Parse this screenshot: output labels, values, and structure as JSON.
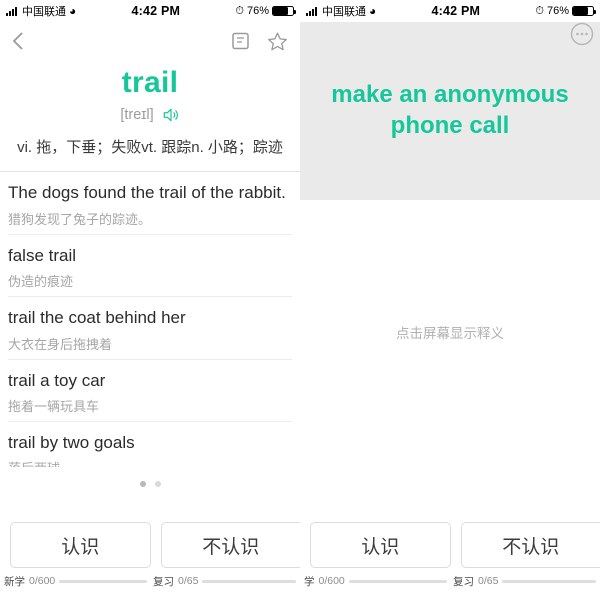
{
  "status_bar": {
    "carrier": "中国联通",
    "wifi_icon": "wifi-icon",
    "time": "4:42 PM",
    "alarm_icon": "alarm-clock-icon",
    "battery_percent": "76%",
    "battery_fill": 76
  },
  "left_screen": {
    "nav": {
      "back_icon": "chevron-left-icon",
      "note_icon": "note-edit-icon",
      "star_icon": "star-outline-icon"
    },
    "word": "trail",
    "phonetic": "[treɪl]",
    "speaker_icon": "speaker-icon",
    "definitions": "vi. 拖，下垂；失败vt. 跟踪n. 小路；踪迹",
    "examples": [
      {
        "en": "The dogs found the trail of the rabbit.",
        "cn": "猎狗发现了兔子的踪迹。"
      },
      {
        "en": "false trail",
        "cn": "伪造的痕迹"
      },
      {
        "en": "trail the coat behind her",
        "cn": "大衣在身后拖拽着"
      },
      {
        "en": "trail a toy car",
        "cn": "拖着一辆玩具车"
      },
      {
        "en": "trail by two goals",
        "cn": "落后两球"
      }
    ],
    "page_dots": {
      "count": 2,
      "active_index": 0
    },
    "answer_buttons": {
      "known": "认识",
      "unknown": "不认识"
    },
    "progress": {
      "new_label": "新学",
      "new_count": "0/600",
      "new_percent": 0,
      "review_label": "复习",
      "review_count": "0/65",
      "review_percent": 0
    }
  },
  "right_screen": {
    "nav": {
      "more_icon": "more-horizontal-icon"
    },
    "phrase": "make an anonymous phone call",
    "tap_hint": "点击屏幕显示释义",
    "answer_buttons": {
      "known": "认识",
      "unknown": "不认识"
    },
    "progress": {
      "new_label": "学",
      "new_count": "0/600",
      "new_percent": 0,
      "review_label": "复习",
      "review_count": "0/65",
      "review_percent": 0
    }
  },
  "colors": {
    "accent": "#16c79a",
    "muted_text": "#a6a6a6",
    "answer_header_bg": "#eaeaea"
  }
}
